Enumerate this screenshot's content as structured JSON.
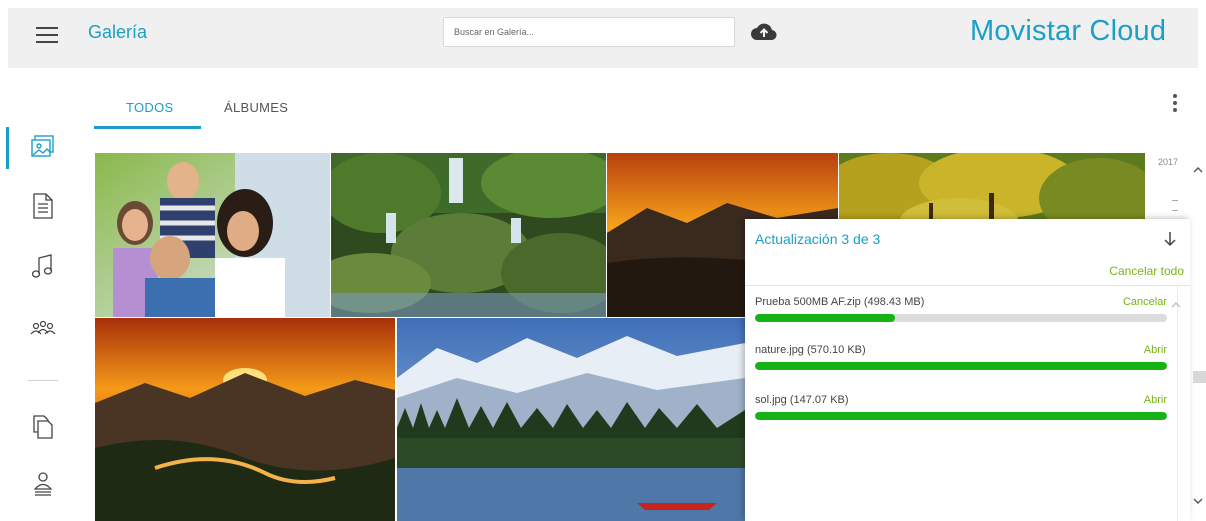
{
  "header": {
    "title": "Galería",
    "search_placeholder": "Buscar en Galería...",
    "brand": "Movistar Cloud",
    "menu_icon": "hamburger-icon",
    "upload_icon": "cloud-upload-icon"
  },
  "colors": {
    "accent": "#1aa0c8",
    "action": "#7ab317",
    "progress": "#16b316"
  },
  "sidebar": {
    "items": [
      {
        "icon": "photos-icon",
        "active": true
      },
      {
        "icon": "document-icon",
        "active": false
      },
      {
        "icon": "music-icon",
        "active": false
      },
      {
        "icon": "contacts-icon",
        "active": false
      },
      {
        "icon": "copy-icon",
        "active": false
      },
      {
        "icon": "profile-icon",
        "active": false
      }
    ]
  },
  "tabs": [
    {
      "label": "TODOS",
      "active": true
    },
    {
      "label": "ÁLBUMES",
      "active": false
    }
  ],
  "more_icon": "kebab-menu-icon",
  "gallery": {
    "year": "2017",
    "photos": [
      {
        "name": "family"
      },
      {
        "name": "waterfall"
      },
      {
        "name": "sunset-mountains"
      },
      {
        "name": "autumn-trees"
      },
      {
        "name": "sunset-river"
      },
      {
        "name": "mountain-lake-canoe"
      }
    ]
  },
  "upload_panel": {
    "title": "Actualización 3 de 3",
    "collapse_icon": "arrow-down-icon",
    "cancel_all": "Cancelar todo",
    "items": [
      {
        "name": "Prueba 500MB AF.zip (498.43 MB)",
        "action": "Cancelar",
        "progress": 0.34
      },
      {
        "name": "nature.jpg (570.10 KB)",
        "action": "Abrir",
        "progress": 1.0
      },
      {
        "name": "sol.jpg (147.07 KB)",
        "action": "Abrir",
        "progress": 1.0
      }
    ]
  }
}
